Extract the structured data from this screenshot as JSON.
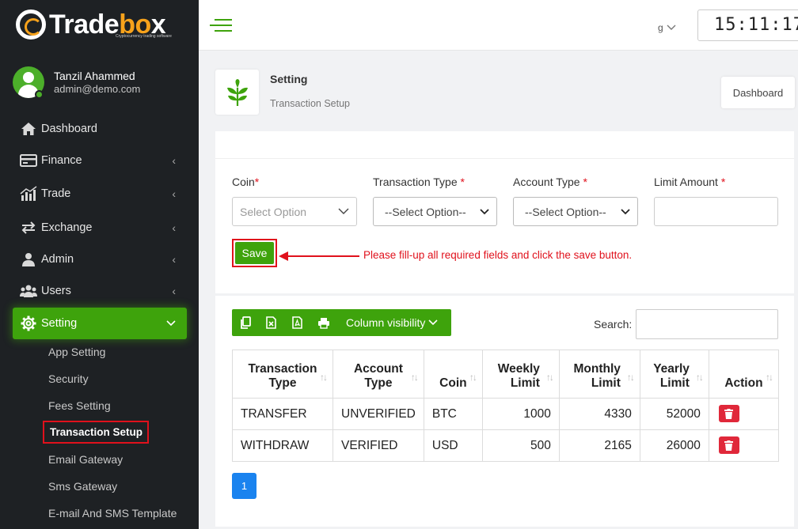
{
  "brand": {
    "name_main": "Trade",
    "name_accent": "bo",
    "name_tail": "x",
    "tagline": "Cryptocurrency trading software"
  },
  "user": {
    "name": "Tanzil Ahammed",
    "email": "admin@demo.com"
  },
  "nav": {
    "dashboard": "Dashboard",
    "finance": "Finance",
    "trade": "Trade",
    "exchange": "Exchange",
    "admin": "Admin",
    "users": "Users",
    "setting": "Setting",
    "sub": [
      "App Setting",
      "Security",
      "Fees Setting",
      "Transaction Setup",
      "Email Gateway",
      "Sms Gateway",
      "E-mail And SMS Template"
    ]
  },
  "topbar": {
    "lang": "g",
    "clock": "15:11:17"
  },
  "page": {
    "title": "Setting",
    "subtitle": "Transaction Setup",
    "dashboard_button": "Dashboard"
  },
  "form": {
    "coin_label": "Coin",
    "coin_placeholder": "Select Option",
    "txn_type_label": "Transaction Type ",
    "txn_type_value": "--Select Option--",
    "account_type_label": "Account Type ",
    "account_type_value": "--Select Option--",
    "limit_label": "Limit Amount ",
    "required_mark": "*",
    "save_label": "Save",
    "hint": "Please fill-up all required fields and click the save button."
  },
  "table": {
    "column_visibility": "Column visibility",
    "search_label": "Search:",
    "headers": {
      "txn_type_1": "Transaction",
      "txn_type_2": "Type",
      "account_type_1": "Account",
      "account_type_2": "Type",
      "coin": "Coin",
      "weekly_1": "Weekly",
      "weekly_2": "Limit",
      "monthly_1": "Monthly",
      "monthly_2": "Limit",
      "yearly_1": "Yearly",
      "yearly_2": "Limit",
      "action": "Action"
    },
    "rows": [
      {
        "txn_type": "TRANSFER",
        "account_type": "UNVERIFIED",
        "coin": "BTC",
        "weekly": "1000",
        "monthly": "4330",
        "yearly": "52000"
      },
      {
        "txn_type": "WITHDRAW",
        "account_type": "VERIFIED",
        "coin": "USD",
        "weekly": "500",
        "monthly": "2165",
        "yearly": "26000"
      }
    ],
    "page": "1"
  },
  "colors": {
    "accent": "#3ea30c",
    "danger": "#e0111c",
    "sidebar": "#1e2124",
    "page_button": "#1a83ef",
    "logo_accent": "#f7a21b"
  }
}
